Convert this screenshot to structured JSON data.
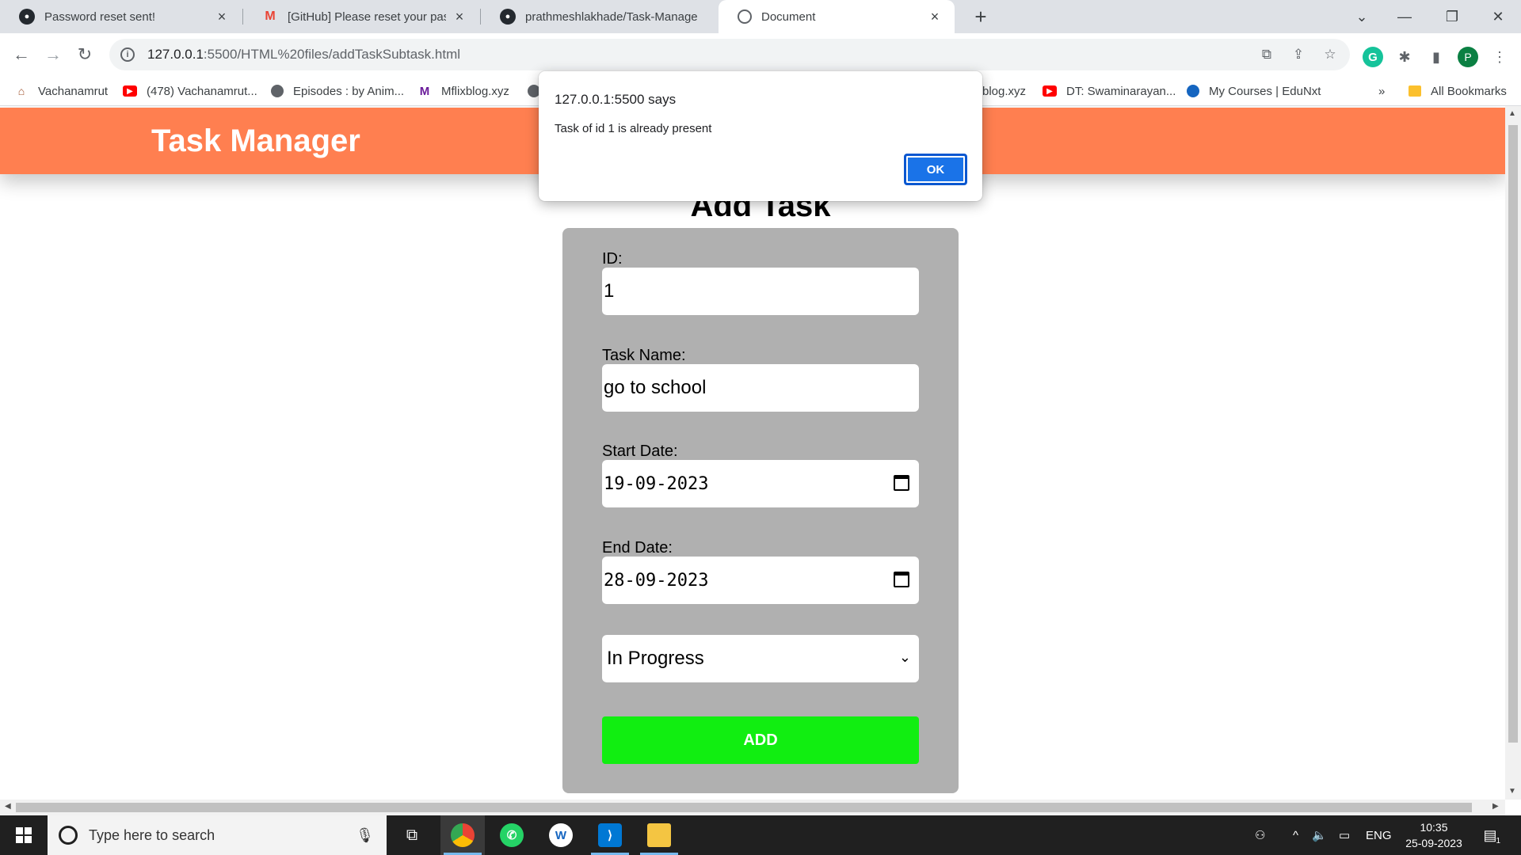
{
  "browser": {
    "tabs": [
      {
        "title": "Password reset sent!",
        "icon": "github-icon"
      },
      {
        "title": "[GitHub] Please reset your passw",
        "icon": "gmail-icon"
      },
      {
        "title": "prathmeshlakhade/Task-Manage",
        "icon": "github-icon"
      },
      {
        "title": "Document",
        "icon": "globe-icon",
        "active": true
      }
    ],
    "new_tab": "+",
    "url": {
      "host": "127.0.0.1",
      "rest": ":5500/HTML%20files/addTaskSubtask.html"
    },
    "profile_initial": "P",
    "grammarly_initial": "G",
    "bookmarks": [
      {
        "label": "Vachanamrut",
        "icon": "temple-icon"
      },
      {
        "label": "(478) Vachanamrut...",
        "icon": "youtube-icon"
      },
      {
        "label": "Episodes : by Anim...",
        "icon": "globe-icon"
      },
      {
        "label": "Mflixblog.xyz",
        "icon": "m-logo-icon"
      },
      {
        "label": "blog.xyz",
        "icon": "globe-icon"
      },
      {
        "label": "DT: Swaminarayan...",
        "icon": "youtube-icon"
      },
      {
        "label": "My Courses | EduNxt",
        "icon": "edunxt-icon"
      }
    ],
    "more_bookmarks": "»",
    "all_bookmarks": "All Bookmarks"
  },
  "page": {
    "app_title": "Task Manager",
    "heading": "Add Task",
    "form": {
      "id_label": "ID:",
      "id_value": "1",
      "name_label": "Task Name:",
      "name_value": "go to school",
      "start_label": "Start Date:",
      "start_value": "19-09-2023",
      "end_label": "End Date:",
      "end_value": "28-09-2023",
      "status_value": "In Progress",
      "submit_label": "ADD"
    }
  },
  "alert": {
    "title": "127.0.0.1:5500 says",
    "message": "Task of id 1 is already present",
    "ok_label": "OK"
  },
  "taskbar": {
    "search_placeholder": "Type here to search",
    "language": "ENG",
    "time": "10:35",
    "date": "25-09-2023",
    "notification_count": "1"
  },
  "colors": {
    "header": "#ff7f50",
    "form_card": "#b0b0b0",
    "add_button": "#11ee11",
    "dialog_button": "#1a73e8"
  }
}
